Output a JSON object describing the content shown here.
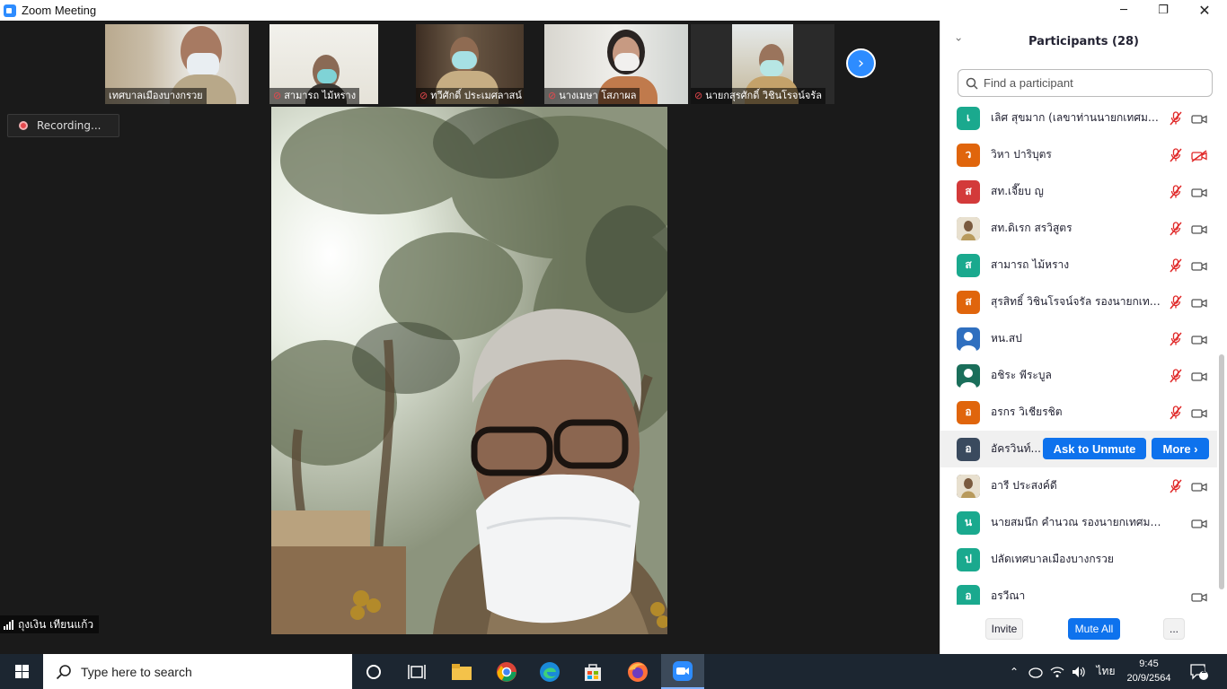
{
  "window": {
    "title": "Zoom Meeting"
  },
  "gallery": [
    {
      "name": "เทศบาลเมืองบางกรวย",
      "muted": false
    },
    {
      "name": "สามารถ ไม้หราง",
      "muted": true
    },
    {
      "name": "ทวีศักดิ์ ประเมศลาสน์",
      "muted": true
    },
    {
      "name": "นางเมษา โสภาผล",
      "muted": true
    },
    {
      "name": "นายกสุรศักดิ์ วิชินโรจน์จรัล",
      "muted": true
    }
  ],
  "recording": {
    "label": "Recording..."
  },
  "active_speaker": {
    "name": "ถุงเงิน เทียนแก้ว"
  },
  "participants_panel": {
    "title": "Participants (28)",
    "search_placeholder": "Find a participant",
    "rows": [
      {
        "initial": "เ",
        "name": "เลิศ สุขมาก (เลขาท่านนายกเทศมนตรี)",
        "color": "#1aa98e",
        "mic_muted": true,
        "video_off": false
      },
      {
        "initial": "ว",
        "name": "วิหา ปาริบุตร",
        "color": "#e0650c",
        "mic_muted": true,
        "video_off": true
      },
      {
        "initial": "ส",
        "name": "สท.เจี๊ยบ ญ",
        "color": "#d33a3a",
        "mic_muted": true,
        "video_off": false
      },
      {
        "initial": "",
        "name": "สท.ดิเรก สรวิสูตร",
        "color": "#9a8c6a",
        "mic_muted": true,
        "video_off": false,
        "photo": true
      },
      {
        "initial": "ส",
        "name": "สามารถ ไม้หราง",
        "color": "#1aa98e",
        "mic_muted": true,
        "video_off": false
      },
      {
        "initial": "ส",
        "name": "สุรสิทธิ์ วิชินโรจน์จรัล รองนายกเทศม...",
        "color": "#e0650c",
        "mic_muted": true,
        "video_off": false
      },
      {
        "initial": "",
        "name": "หน.สป",
        "color": "#2f6fbf",
        "mic_muted": true,
        "video_off": false,
        "person": true
      },
      {
        "initial": "",
        "name": "อชิระ พีระบูล",
        "color": "#1a6e5a",
        "mic_muted": true,
        "video_off": false,
        "person": true
      },
      {
        "initial": "อ",
        "name": "อรกร วิเชียรชิต",
        "color": "#e0650c",
        "mic_muted": true,
        "video_off": false
      },
      {
        "initial": "อ",
        "name": "อัครวินท์...",
        "color": "#3a4a5e",
        "hover": true
      },
      {
        "initial": "",
        "name": "อารี ประสงค์ดี",
        "color": "#4a3a20",
        "mic_muted": true,
        "video_off": false,
        "photo": true
      },
      {
        "initial": "น",
        "name": "นายสมนึก คำนวณ รองนายกเทศมนตรีเมือ...",
        "color": "#1aa98e",
        "mic_muted": false,
        "video_off": false
      },
      {
        "initial": "ป",
        "name": "ปลัดเทศบาลเมืองบางกรวย",
        "color": "#1aa98e",
        "no_icons": true
      },
      {
        "initial": "อ",
        "name": "อรวีณา",
        "color": "#1aa98e",
        "mic_muted": false,
        "video_off": false
      }
    ],
    "ask_to_unmute_label": "Ask to Unmute",
    "more_label": "More ›",
    "footer": {
      "invite": "Invite",
      "mute_all": "Mute All",
      "more": "..."
    }
  },
  "taskbar": {
    "search_placeholder": "Type here to search",
    "time": "9:45",
    "date": "20/9/2564",
    "language": "ไทย",
    "notifications": "1"
  }
}
